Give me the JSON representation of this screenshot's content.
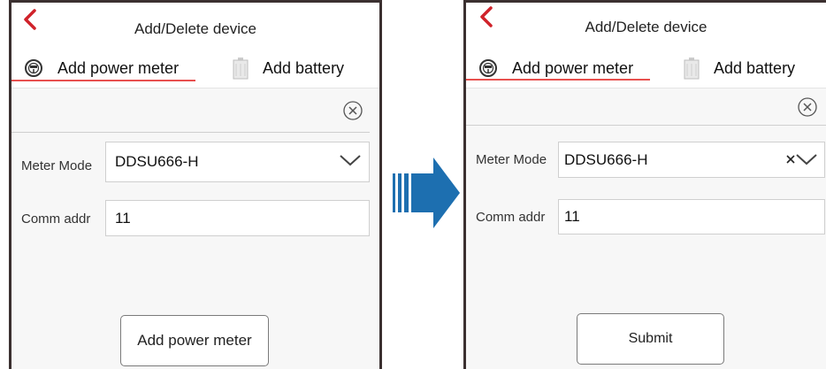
{
  "colors": {
    "accent_red": "#d0222a",
    "arrow_blue": "#1d6fb0",
    "frame": "#3b3030",
    "tab_underline": "#e8504f"
  },
  "left": {
    "title": "Add/Delete device",
    "tabs": [
      {
        "label": "Add power meter",
        "icon": "power-meter-icon",
        "active": true
      },
      {
        "label": "Add battery",
        "icon": "battery-icon",
        "active": false
      }
    ],
    "meter_mode_label": "Meter Mode",
    "meter_mode_value": "DDSU666-H",
    "comm_addr_label": "Comm addr",
    "comm_addr_value": "11",
    "action_button": "Add power meter"
  },
  "right": {
    "title": "Add/Delete device",
    "tabs": [
      {
        "label": "Add power meter",
        "icon": "power-meter-icon",
        "active": true
      },
      {
        "label": "Add battery",
        "icon": "battery-icon",
        "active": false
      }
    ],
    "meter_mode_label": "Meter Mode",
    "meter_mode_value": "DDSU666-H",
    "comm_addr_label": "Comm addr",
    "comm_addr_value": "11",
    "action_button": "Submit"
  },
  "transition_icon": "right-arrow-icon"
}
